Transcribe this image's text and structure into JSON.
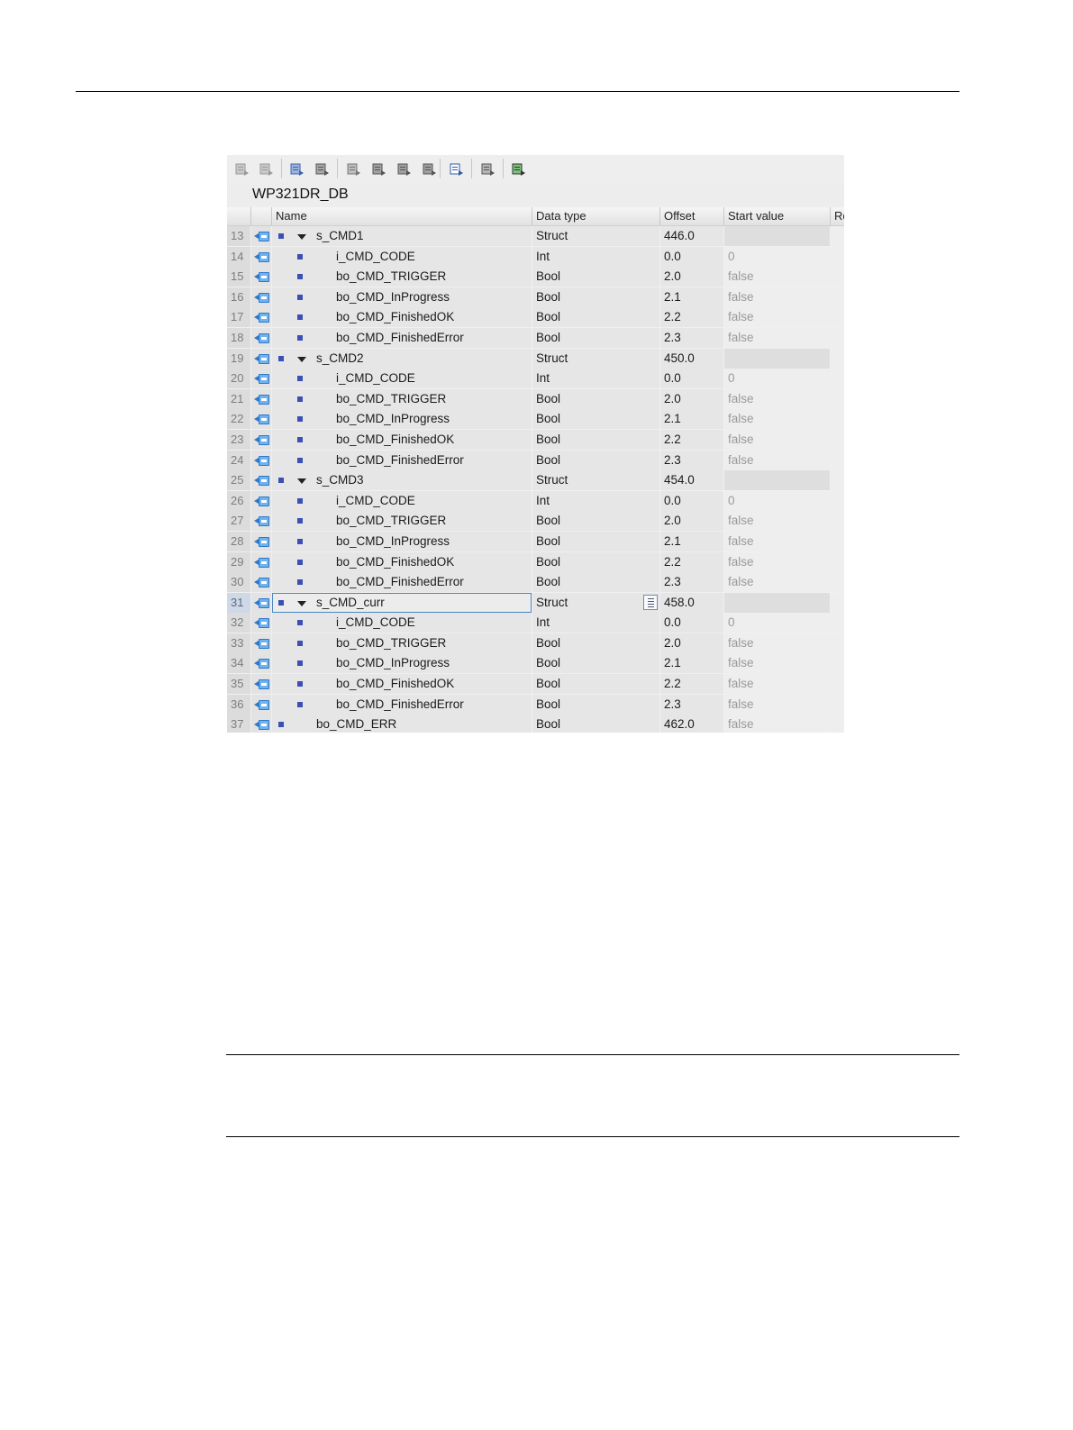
{
  "toolbar": {
    "buttons": [
      {
        "icon": "insert-row-icon"
      },
      {
        "icon": "add-row-icon"
      },
      {
        "icon": "snapshot-icon"
      },
      {
        "icon": "copy-snapshot-icon"
      },
      {
        "icon": "reset-start-values-icon"
      },
      {
        "icon": "load-start-values-icon"
      },
      {
        "icon": "load-snapshot-icon"
      },
      {
        "icon": "export-icon"
      },
      {
        "icon": "keep-actual-values-icon"
      },
      {
        "icon": "expand-all-icon"
      },
      {
        "icon": "monitor-all-icon"
      }
    ]
  },
  "editor": {
    "db_name": "WP321DR_DB",
    "columns": {
      "name": "Name",
      "data_type": "Data type",
      "offset": "Offset",
      "start_value": "Start value",
      "retain": "Re"
    },
    "rows": [
      {
        "num": "13",
        "name": "s_CMD1",
        "type": "Struct",
        "offset": "446.0",
        "start": "",
        "level": 0,
        "expand": true
      },
      {
        "num": "14",
        "name": "i_CMD_CODE",
        "type": "Int",
        "offset": "0.0",
        "start": "0",
        "level": 1
      },
      {
        "num": "15",
        "name": "bo_CMD_TRIGGER",
        "type": "Bool",
        "offset": "2.0",
        "start": "false",
        "level": 1
      },
      {
        "num": "16",
        "name": "bo_CMD_InProgress",
        "type": "Bool",
        "offset": "2.1",
        "start": "false",
        "level": 1
      },
      {
        "num": "17",
        "name": "bo_CMD_FinishedOK",
        "type": "Bool",
        "offset": "2.2",
        "start": "false",
        "level": 1
      },
      {
        "num": "18",
        "name": "bo_CMD_FinishedError",
        "type": "Bool",
        "offset": "2.3",
        "start": "false",
        "level": 1
      },
      {
        "num": "19",
        "name": "s_CMD2",
        "type": "Struct",
        "offset": "450.0",
        "start": "",
        "level": 0,
        "expand": true
      },
      {
        "num": "20",
        "name": "i_CMD_CODE",
        "type": "Int",
        "offset": "0.0",
        "start": "0",
        "level": 1
      },
      {
        "num": "21",
        "name": "bo_CMD_TRIGGER",
        "type": "Bool",
        "offset": "2.0",
        "start": "false",
        "level": 1
      },
      {
        "num": "22",
        "name": "bo_CMD_InProgress",
        "type": "Bool",
        "offset": "2.1",
        "start": "false",
        "level": 1
      },
      {
        "num": "23",
        "name": "bo_CMD_FinishedOK",
        "type": "Bool",
        "offset": "2.2",
        "start": "false",
        "level": 1
      },
      {
        "num": "24",
        "name": "bo_CMD_FinishedError",
        "type": "Bool",
        "offset": "2.3",
        "start": "false",
        "level": 1
      },
      {
        "num": "25",
        "name": "s_CMD3",
        "type": "Struct",
        "offset": "454.0",
        "start": "",
        "level": 0,
        "expand": true
      },
      {
        "num": "26",
        "name": "i_CMD_CODE",
        "type": "Int",
        "offset": "0.0",
        "start": "0",
        "level": 1
      },
      {
        "num": "27",
        "name": "bo_CMD_TRIGGER",
        "type": "Bool",
        "offset": "2.0",
        "start": "false",
        "level": 1
      },
      {
        "num": "28",
        "name": "bo_CMD_InProgress",
        "type": "Bool",
        "offset": "2.1",
        "start": "false",
        "level": 1
      },
      {
        "num": "29",
        "name": "bo_CMD_FinishedOK",
        "type": "Bool",
        "offset": "2.2",
        "start": "false",
        "level": 1
      },
      {
        "num": "30",
        "name": "bo_CMD_FinishedError",
        "type": "Bool",
        "offset": "2.3",
        "start": "false",
        "level": 1
      },
      {
        "num": "31",
        "name": "s_CMD_curr",
        "type": "Struct",
        "offset": "458.0",
        "start": "",
        "level": 0,
        "expand": true,
        "selected": true
      },
      {
        "num": "32",
        "name": "i_CMD_CODE",
        "type": "Int",
        "offset": "0.0",
        "start": "0",
        "level": 1
      },
      {
        "num": "33",
        "name": "bo_CMD_TRIGGER",
        "type": "Bool",
        "offset": "2.0",
        "start": "false",
        "level": 1
      },
      {
        "num": "34",
        "name": "bo_CMD_InProgress",
        "type": "Bool",
        "offset": "2.1",
        "start": "false",
        "level": 1
      },
      {
        "num": "35",
        "name": "bo_CMD_FinishedOK",
        "type": "Bool",
        "offset": "2.2",
        "start": "false",
        "level": 1
      },
      {
        "num": "36",
        "name": "bo_CMD_FinishedError",
        "type": "Bool",
        "offset": "2.3",
        "start": "false",
        "level": 1
      },
      {
        "num": "37",
        "name": "bo_CMD_ERR",
        "type": "Bool",
        "offset": "462.0",
        "start": "false",
        "level": 0
      }
    ]
  },
  "colors": {
    "member_marker": "#3c4fb3",
    "interface_icon": "#2f77c9",
    "selection": "#4a86c5"
  }
}
